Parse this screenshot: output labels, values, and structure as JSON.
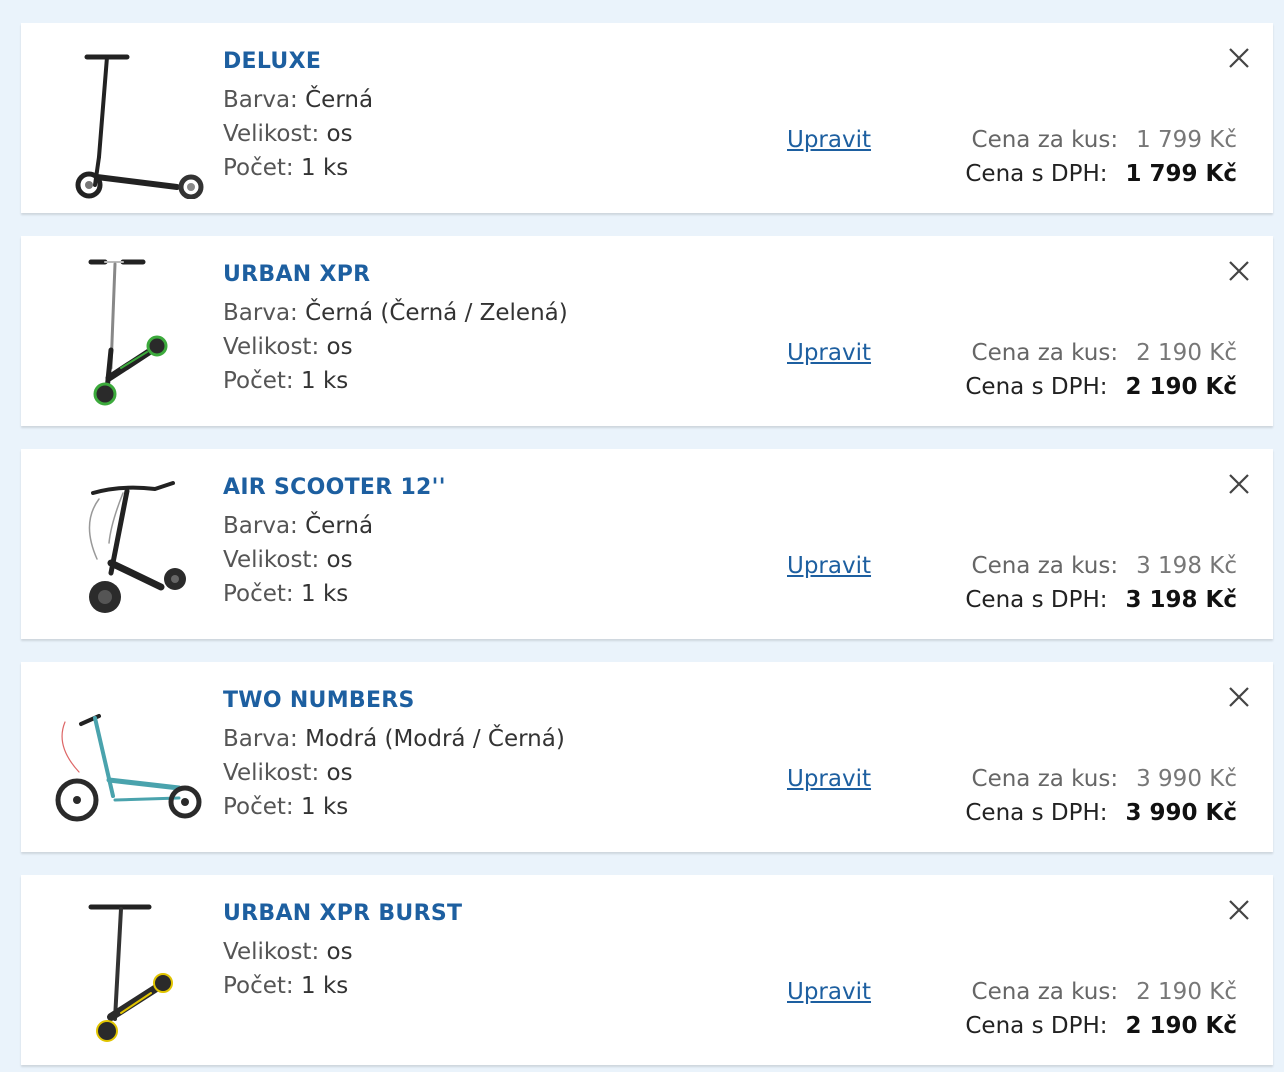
{
  "cart": {
    "items": [
      {
        "name": "DELUXE",
        "attrs": [
          {
            "label": "Barva:",
            "value": "Černá"
          },
          {
            "label": "Velikost:",
            "value": "os"
          },
          {
            "label": "Počet:",
            "value": "1 ks"
          }
        ],
        "edit_label": "Upravit",
        "unit_price_label": "Cena za kus:",
        "unit_price": "1 799 Kč",
        "vat_price_label": "Cena s DPH:",
        "vat_price": "1 799 Kč",
        "image_icon": "black-scooter-image"
      },
      {
        "name": "URBAN XPR",
        "attrs": [
          {
            "label": "Barva:",
            "value": "Černá (Černá / Zelená)"
          },
          {
            "label": "Velikost:",
            "value": "os"
          },
          {
            "label": "Počet:",
            "value": "1 ks"
          }
        ],
        "edit_label": "Upravit",
        "unit_price_label": "Cena za kus:",
        "unit_price": "2 190 Kč",
        "vat_price_label": "Cena s DPH:",
        "vat_price": "2 190 Kč",
        "image_icon": "black-green-scooter-image"
      },
      {
        "name": "AIR SCOOTER 12''",
        "attrs": [
          {
            "label": "Barva:",
            "value": "Černá"
          },
          {
            "label": "Velikost:",
            "value": "os"
          },
          {
            "label": "Počet:",
            "value": "1 ks"
          }
        ],
        "edit_label": "Upravit",
        "unit_price_label": "Cena za kus:",
        "unit_price": "3 198 Kč",
        "vat_price_label": "Cena s DPH:",
        "vat_price": "3 198 Kč",
        "image_icon": "air-scooter-image"
      },
      {
        "name": "TWO NUMBERS",
        "attrs": [
          {
            "label": "Barva:",
            "value": "Modrá (Modrá / Černá)"
          },
          {
            "label": "Velikost:",
            "value": "os"
          },
          {
            "label": "Počet:",
            "value": "1 ks"
          }
        ],
        "edit_label": "Upravit",
        "unit_price_label": "Cena za kus:",
        "unit_price": "3 990 Kč",
        "vat_price_label": "Cena s DPH:",
        "vat_price": "3 990 Kč",
        "image_icon": "blue-kick-scooter-image"
      },
      {
        "name": "URBAN XPR BURST",
        "attrs": [
          {
            "label": "Velikost:",
            "value": "os"
          },
          {
            "label": "Počet:",
            "value": "1 ks"
          }
        ],
        "edit_label": "Upravit",
        "unit_price_label": "Cena za kus:",
        "unit_price": "2 190 Kč",
        "vat_price_label": "Cena s DPH:",
        "vat_price": "2 190 Kč",
        "image_icon": "black-yellow-scooter-image"
      }
    ],
    "close_icon": "close-icon"
  },
  "colors": {
    "page_background": "#eaf3fb",
    "card_background": "#ffffff",
    "accent": "#1d5fa0",
    "text": "#555555",
    "price_bold": "#111111"
  }
}
